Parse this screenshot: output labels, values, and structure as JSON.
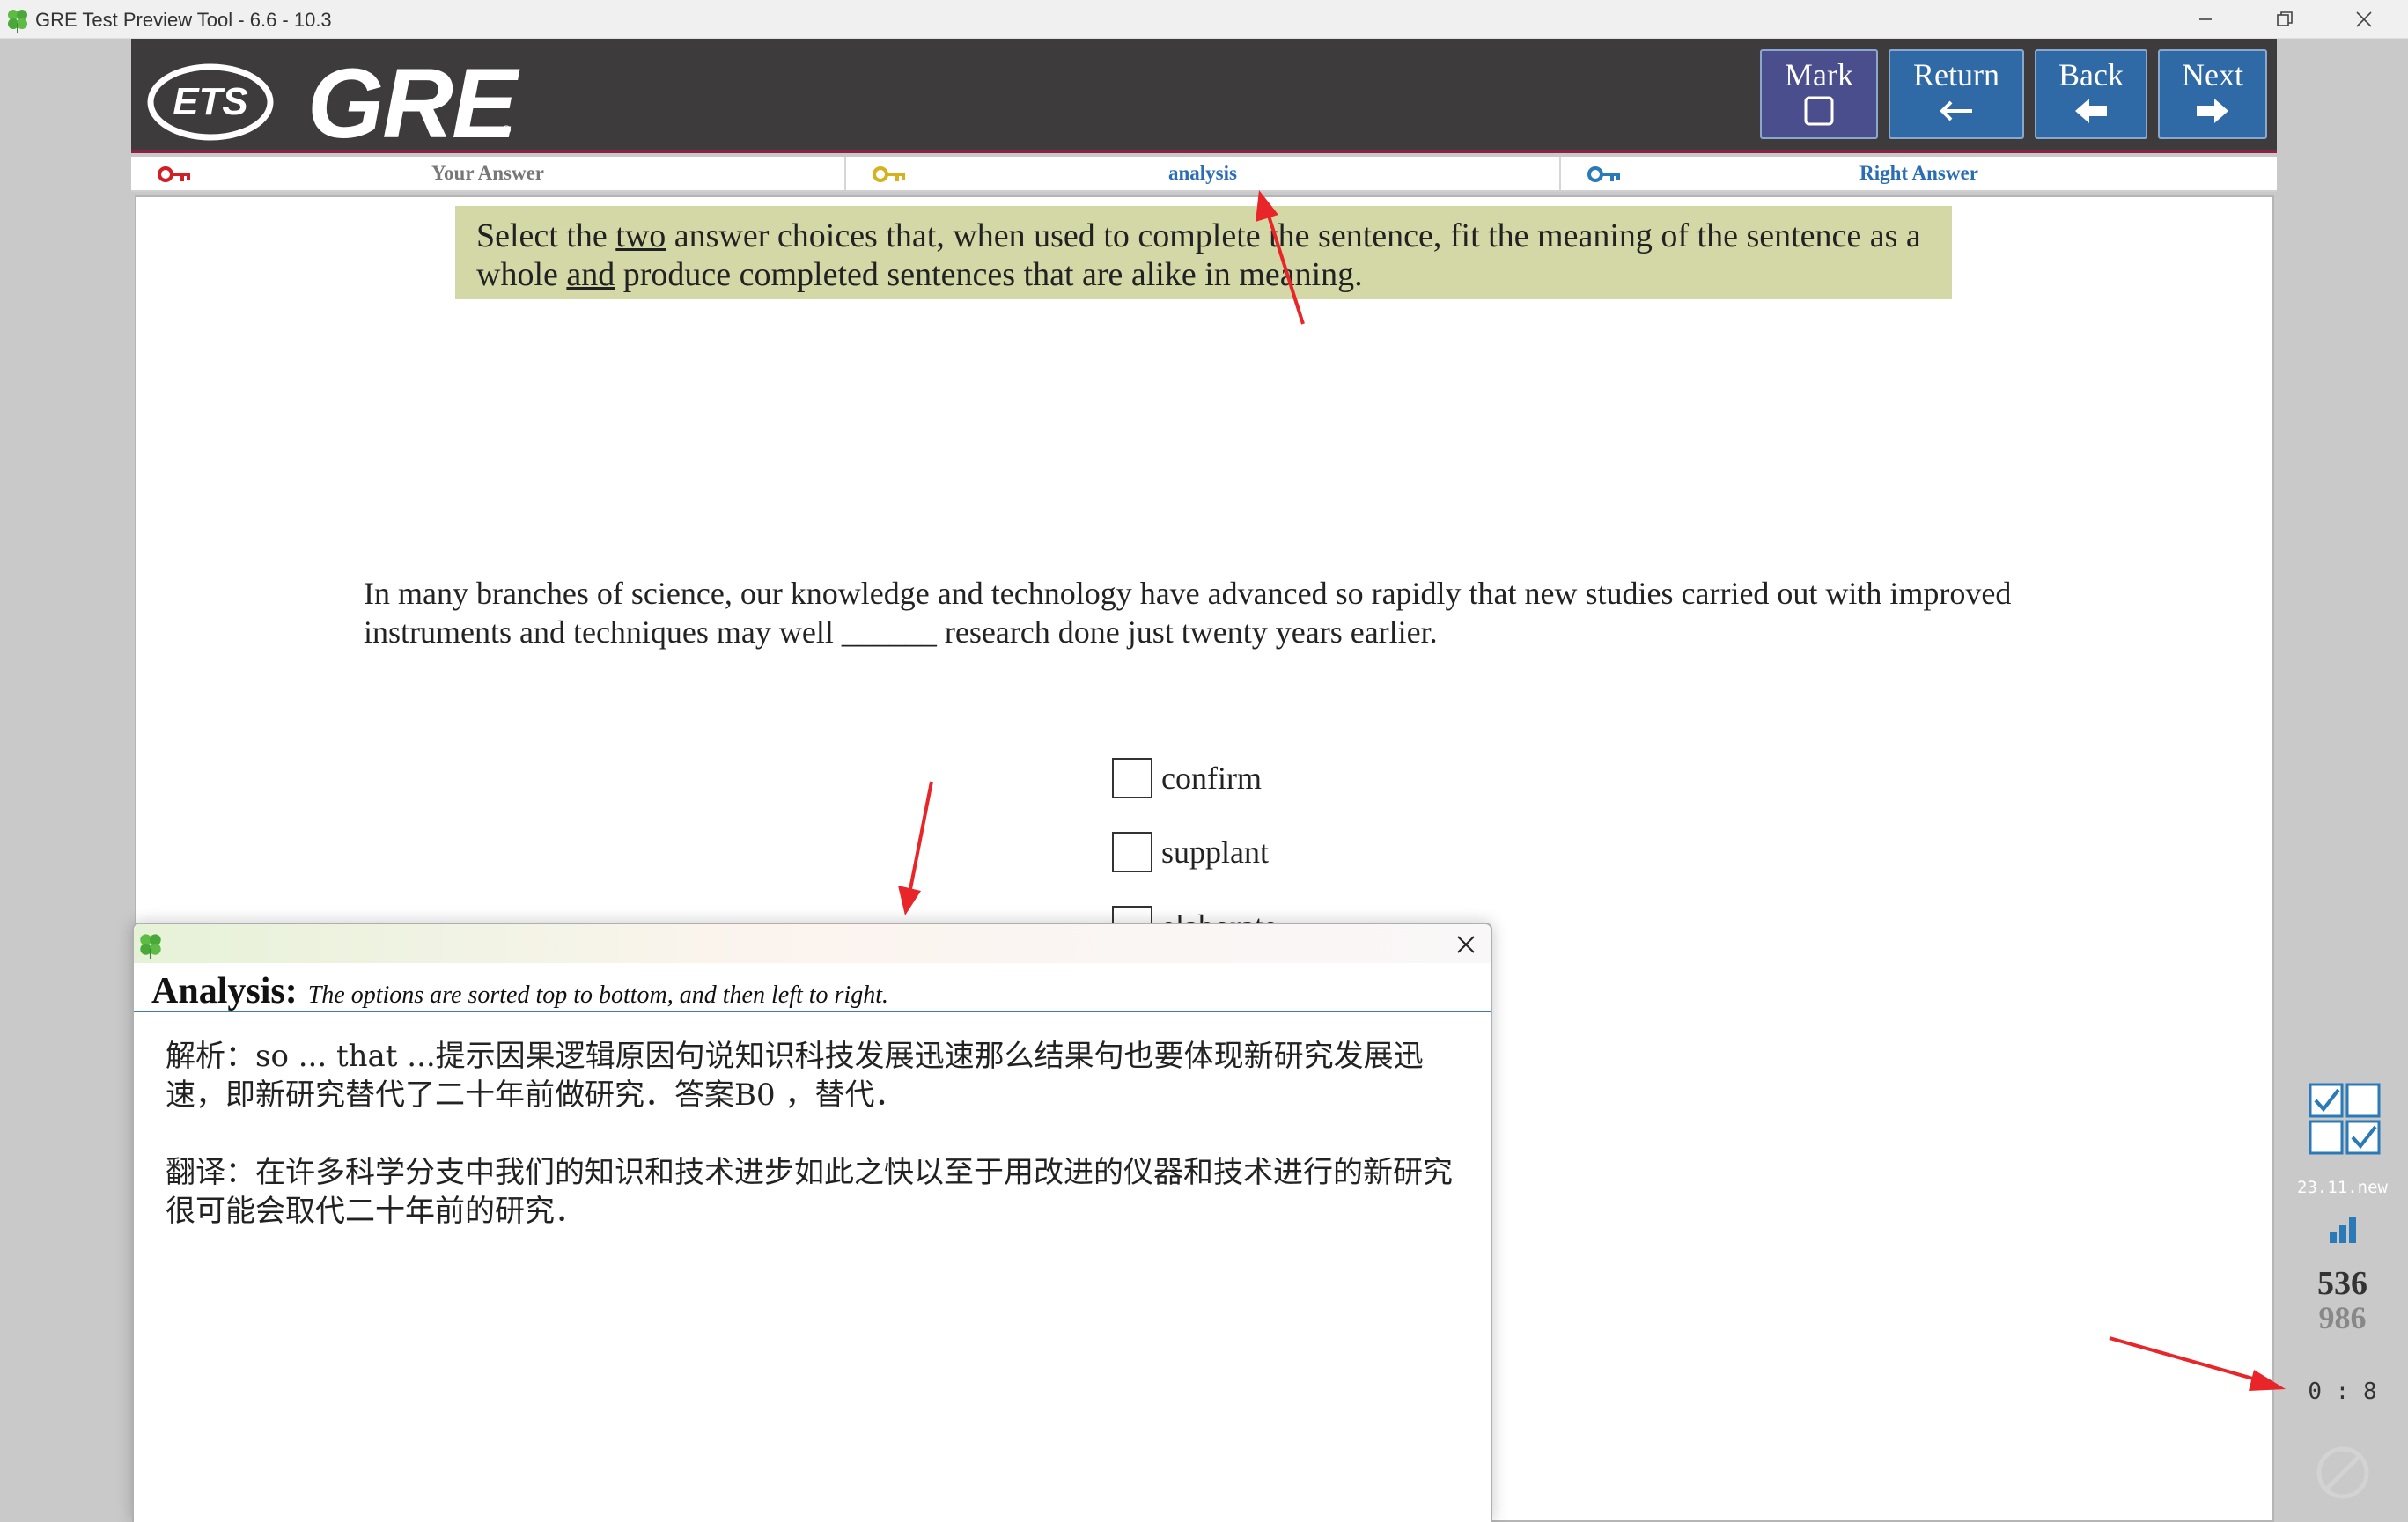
{
  "window": {
    "title": "GRE Test Preview Tool - 6.6 - 10.3"
  },
  "header": {
    "logo_text": "ETS",
    "product": "GRE",
    "registered": "®"
  },
  "toolbar": {
    "mark_label": "Mark",
    "return_label": "Return",
    "back_label": "Back",
    "next_label": "Next"
  },
  "tabs": {
    "your_answer": "Your Answer",
    "analysis": "analysis",
    "right_answer": "Right Answer"
  },
  "question": {
    "instruction_pre": "Select the ",
    "instruction_u1": "two",
    "instruction_mid": " answer choices that, when used to complete the sentence, fit the meaning of the sentence as a whole ",
    "instruction_u2": "and",
    "instruction_post": " produce completed sentences that are alike in meaning.",
    "stem": "In many branches of science, our knowledge and technology have advanced so rapidly that new studies carried out with improved instruments and techniques may well ______ research done just twenty years earlier.",
    "choices": [
      "confirm",
      "supplant",
      "elaborate"
    ]
  },
  "sidebar": {
    "version": "23.11.new",
    "count_current": "536",
    "count_total": "986",
    "timer": "0 : 8"
  },
  "analysis_popup": {
    "heading": "Analysis:",
    "subheading": "The options are sorted top to bottom, and then left to right.",
    "paragraph1": "解析：so ... that ...提示因果逻辑原因句说知识科技发展迅速那么结果句也要体现新研究发展迅速，即新研究替代了二十年前做研究．答案B0 ，替代．",
    "paragraph2": "翻译：在许多科学分支中我们的知识和技术进步如此之快以至于用改进的仪器和技术进行的新研究很可能会取代二十年前的研究．"
  },
  "colors": {
    "header_bg": "#3d3b3b",
    "accent_blue": "#2f6aa6",
    "mark_purple": "#4b4e8c",
    "instruction_bg": "#d4d7a6",
    "tab_link": "#2a6db4",
    "annotation_red": "#e8262a"
  },
  "icons": [
    "clover-icon",
    "minimize-icon",
    "maximize-icon",
    "close-icon",
    "key-red-icon",
    "key-yellow-icon",
    "key-blue-icon",
    "arrow-left-icon",
    "arrow-right-icon",
    "checkbox-grid-icon",
    "bar-chart-icon",
    "stop-icon"
  ]
}
